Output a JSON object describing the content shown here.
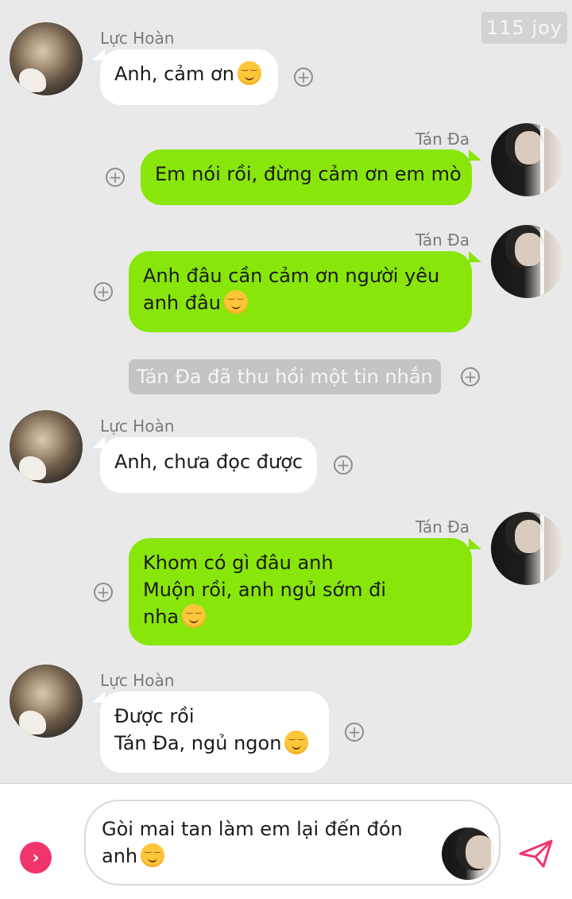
{
  "watermark": "115 joy",
  "messages": [
    {
      "sender": "Lực Hoàn",
      "lines": [
        "Anh, cảm ơn"
      ],
      "emoji": "smiling-face-emoji"
    },
    {
      "sender": "Tán Đa",
      "lines": [
        "Em nói rồi, đừng cảm ơn em mò"
      ]
    },
    {
      "sender": "Tán Đa",
      "lines": [
        "Anh đâu cần cảm ơn người yêu",
        "anh đâu"
      ],
      "emoji": "relieved-face-emoji"
    },
    {
      "recall_notice": "Tán Đa đã thu hồi một tin nhắn"
    },
    {
      "sender": "Lực Hoàn",
      "lines": [
        "Anh, chưa đọc được"
      ]
    },
    {
      "sender": "Tán Đa",
      "lines": [
        "Khom có gì đâu anh",
        "Muộn rồi, anh ngủ sớm đi",
        "nha"
      ],
      "emoji": "smiling-face-emoji"
    },
    {
      "sender": "Lực Hoàn",
      "lines": [
        "Được rồi",
        "Tán Đa, ngủ ngon"
      ],
      "emoji": "smiling-face-emoji"
    }
  ],
  "composer": {
    "lines": [
      "Gòi mai tan làm em lại đến đón",
      "anh"
    ],
    "emoji": "relieved-face-emoji"
  },
  "colors": {
    "sent_bubble": "#89e60a",
    "received_bubble": "#ffffff",
    "background": "#e9e9e9",
    "expand_button": "#f0346c",
    "send_icon": "#f0346c"
  }
}
